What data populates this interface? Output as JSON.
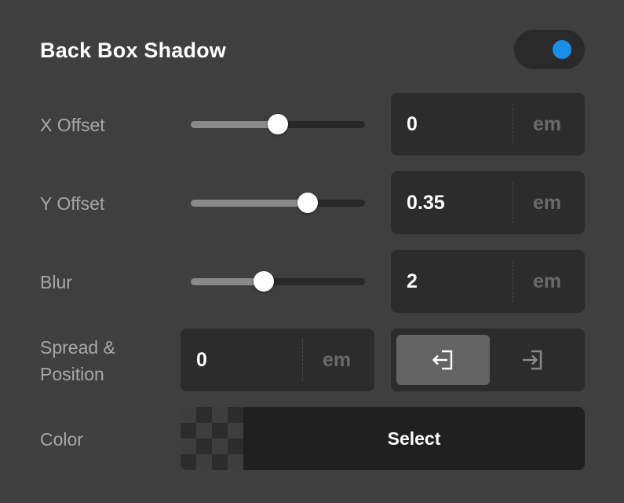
{
  "panel": {
    "title": "Back Box Shadow",
    "enabled": true,
    "toggle_color": "#1a8fe8"
  },
  "x_offset": {
    "label": "X Offset",
    "value": "0",
    "unit": "em",
    "slider_fraction": 0.5
  },
  "y_offset": {
    "label": "Y Offset",
    "value": "0.35",
    "unit": "em",
    "slider_fraction": 0.67
  },
  "blur": {
    "label": "Blur",
    "value": "2",
    "unit": "em",
    "slider_fraction": 0.42
  },
  "spread": {
    "label_line1": "Spread &",
    "label_line2": "Position",
    "value": "0",
    "unit": "em",
    "position_options": [
      {
        "icon": "outset-icon",
        "selected": true
      },
      {
        "icon": "inset-icon",
        "selected": false
      }
    ]
  },
  "color": {
    "label": "Color",
    "button_label": "Select"
  }
}
